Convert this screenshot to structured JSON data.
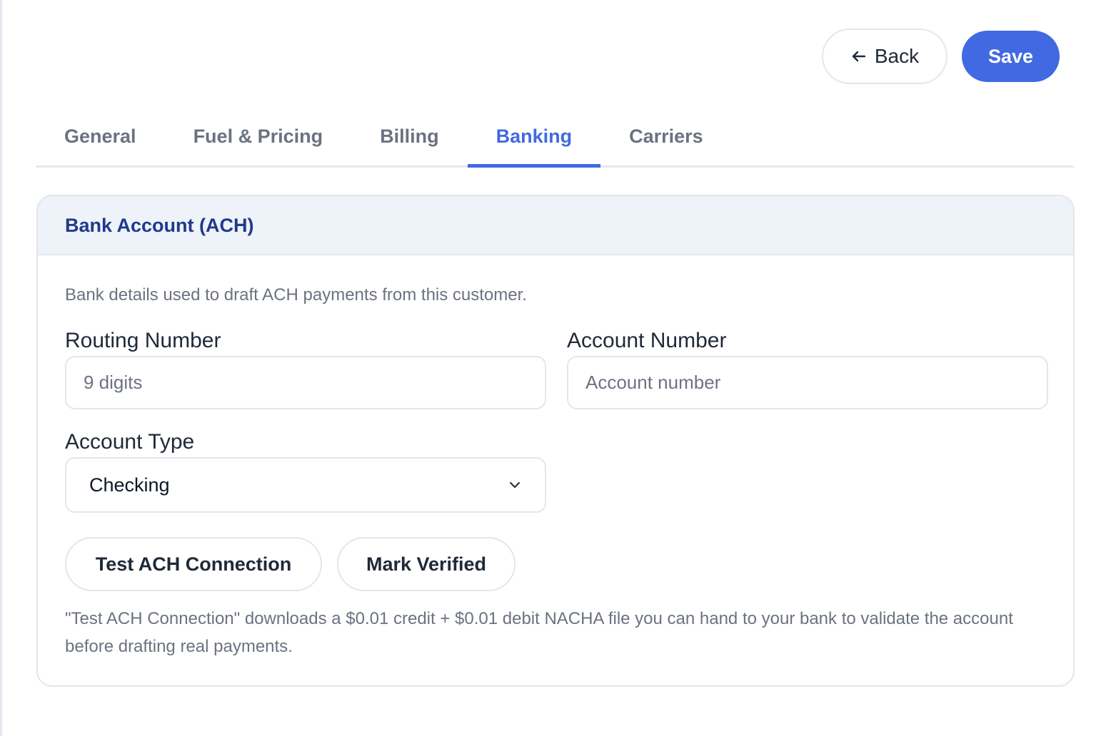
{
  "header": {
    "back_label": "Back",
    "save_label": "Save"
  },
  "tabs": [
    {
      "label": "General",
      "active": false
    },
    {
      "label": "Fuel & Pricing",
      "active": false
    },
    {
      "label": "Billing",
      "active": false
    },
    {
      "label": "Banking",
      "active": true
    },
    {
      "label": "Carriers",
      "active": false
    }
  ],
  "card": {
    "title": "Bank Account (ACH)",
    "description": "Bank details used to draft ACH payments from this customer.",
    "routing": {
      "label": "Routing Number",
      "value": "",
      "placeholder": "9 digits"
    },
    "account": {
      "label": "Account Number",
      "value": "",
      "placeholder": "Account number"
    },
    "account_type": {
      "label": "Account Type",
      "selected": "Checking"
    },
    "test_button_label": "Test ACH Connection",
    "verify_button_label": "Mark Verified",
    "help_text": "\"Test ACH Connection\" downloads a $0.01 credit + $0.01 debit NACHA file you can hand to your bank to validate the account before drafting real payments."
  },
  "colors": {
    "accent": "#4169e1",
    "card_title": "#1e3a8a",
    "muted_text": "#6b7280"
  },
  "icons": {
    "back": "arrow-left-icon",
    "select": "chevron-down-icon"
  }
}
